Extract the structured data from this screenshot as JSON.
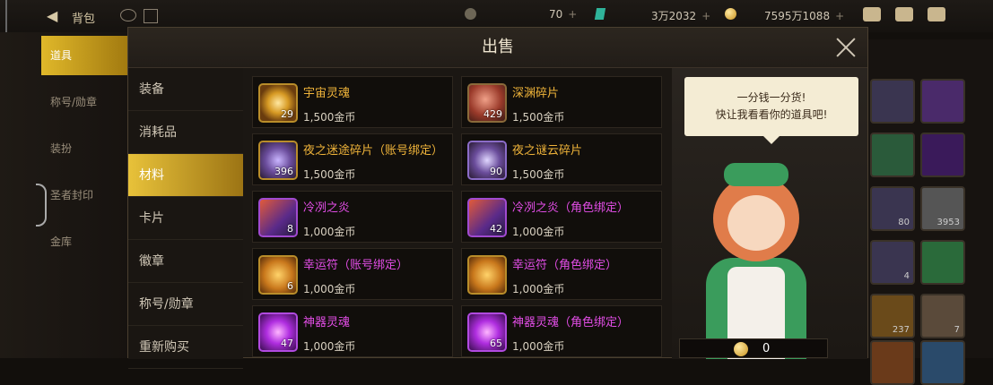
{
  "topbar": {
    "back_icon": "back-arrow-icon",
    "title": "背包",
    "res1_value": "70",
    "res2_value": "3万2032",
    "res3_value": "7595万1088"
  },
  "left_nav": {
    "items": [
      "道具",
      "称号/勋章",
      "装扮",
      "圣者封印",
      "金库"
    ]
  },
  "right_grid": {
    "counts": [
      "80",
      "3953",
      "4",
      "237",
      "7"
    ]
  },
  "modal": {
    "title": "出售",
    "categories": [
      "装备",
      "消耗品",
      "材料",
      "卡片",
      "徽章",
      "称号/勋章",
      "重新购买"
    ],
    "active_category": "材料",
    "items": [
      {
        "name": "宇宙灵魂",
        "count": "29",
        "price": "1,500金币",
        "color": "#f0b43a"
      },
      {
        "name": "深渊碎片",
        "count": "429",
        "price": "1,500金币",
        "color": "#f0b43a"
      },
      {
        "name": "夜之迷途碎片（账号绑定）",
        "count": "396",
        "price": "1,500金币",
        "color": "#f0b43a"
      },
      {
        "name": "夜之谜云碎片",
        "count": "90",
        "price": "1,500金币",
        "color": "#f0b43a"
      },
      {
        "name": "冷冽之炎",
        "count": "8",
        "price": "1,000金币",
        "color": "#e24de6"
      },
      {
        "name": "冷冽之炎（角色绑定）",
        "count": "42",
        "price": "1,000金币",
        "color": "#e24de6"
      },
      {
        "name": "幸运符（账号绑定）",
        "count": "6",
        "price": "1,000金币",
        "color": "#e24de6"
      },
      {
        "name": "幸运符（角色绑定）",
        "count": "",
        "price": "1,000金币",
        "color": "#e24de6"
      },
      {
        "name": "神器灵魂",
        "count": "47",
        "price": "1,000金币",
        "color": "#e24de6"
      },
      {
        "name": "神器灵魂（角色绑定）",
        "count": "65",
        "price": "1,000金币",
        "color": "#e24de6"
      }
    ],
    "npc_line1": "一分钱一分货!",
    "npc_line2": "快让我看看你的道具吧!",
    "total_value": "0"
  }
}
